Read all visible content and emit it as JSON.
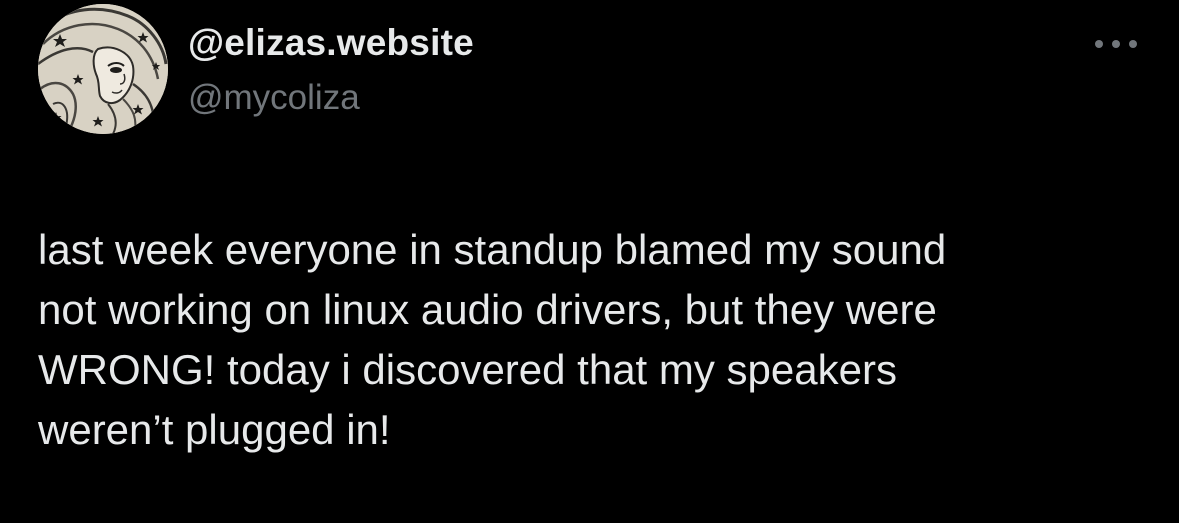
{
  "author": {
    "display_name": "@elizas.website",
    "handle": "@mycoliza",
    "avatar_icon": "illustrated-portrait-avatar"
  },
  "actions": {
    "more_icon": "more-horizontal-icon"
  },
  "tweet": {
    "lines": [
      "last week everyone in standup blamed my sound",
      "not working on linux audio drivers, but they were",
      "WRONG! today i discovered that my speakers",
      "weren’t plugged in!"
    ]
  },
  "colors": {
    "background": "#000000",
    "primary_text": "#e7e9ea",
    "secondary_text": "#71767b"
  }
}
